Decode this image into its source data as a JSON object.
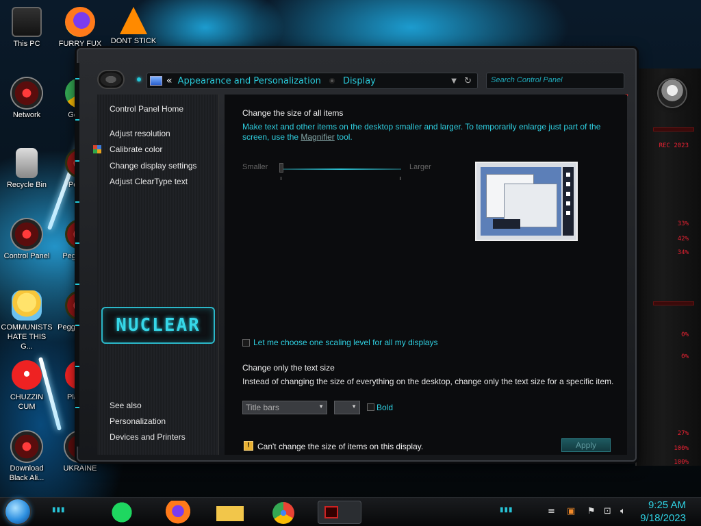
{
  "desktop": {
    "icons_col1": [
      {
        "label": "This PC",
        "icon": "computer-icon"
      },
      {
        "label": "Network",
        "icon": "network-icon"
      },
      {
        "label": "Recycle Bin",
        "icon": "recycle-bin-icon"
      },
      {
        "label": "Control Panel",
        "icon": "control-panel-icon"
      },
      {
        "label": "COMMUNISTS HATE THIS G...",
        "icon": "star-butterfly-icon"
      },
      {
        "label": "CHUZZIN CUM",
        "icon": "chuzzle-icon"
      },
      {
        "label": "Download Black Ali...",
        "icon": "alienware-icon"
      }
    ],
    "icons_col2": [
      {
        "label": "FURRY FUX",
        "icon": "firefox-icon"
      },
      {
        "label": "Go Chr",
        "icon": "chrome-icon"
      },
      {
        "label": "Peggle",
        "icon": "peggle-icon"
      },
      {
        "label": "Peggle De",
        "icon": "peggle-icon"
      },
      {
        "label": "Peggle of Wa",
        "icon": "peggle-icon"
      },
      {
        "label": "Plan Zo",
        "icon": "pvz-icon"
      },
      {
        "label": "UKRAINE",
        "icon": "ukraine-icon"
      }
    ],
    "icons_col3": [
      {
        "label": "DONT STICK",
        "icon": "vlc-icon"
      }
    ]
  },
  "gadgets": {
    "readouts": [
      "33%",
      "42%",
      "34%",
      "0%",
      "0%",
      "27%",
      "100%",
      "100%"
    ],
    "header": "REC 2023"
  },
  "window": {
    "breadcrumb": {
      "chevron": "«",
      "parent": "Appearance and Personalization",
      "current": "Display"
    },
    "search": {
      "placeholder": "Search Control Panel"
    },
    "help": "?"
  },
  "left_pane": {
    "home": "Control Panel Home",
    "links": [
      "Adjust resolution",
      "Calibrate color",
      "Change display settings",
      "Adjust ClearType text"
    ],
    "logo": "NUCLEAR",
    "see_also": "See also",
    "see_also_links": [
      "Personalization",
      "Devices and Printers"
    ]
  },
  "content": {
    "heading1": "Change the size of all items",
    "desc1_a": "Make text and other items on the desktop smaller and larger. To temporarily enlarge just part of the screen, use the ",
    "desc1_link": "Magnifier",
    "desc1_b": " tool.",
    "slider": {
      "min_label": "Smaller",
      "max_label": "Larger",
      "value": 0
    },
    "checkbox_label": "Let me choose one scaling level for all my displays",
    "checkbox_checked": false,
    "heading2": "Change only the text size",
    "desc2": "Instead of changing the size of everything on the desktop, change only the text size for a specific item.",
    "item_select": "Title bars",
    "size_select": "",
    "bold_label": "Bold",
    "bold_checked": false,
    "warning": "Can't change the size of items on this display.",
    "apply_label": "Apply"
  },
  "taskbar": {
    "apps": [
      "spotify-icon",
      "firefox-icon",
      "file-explorer-icon",
      "chrome-icon",
      "control-panel-icon"
    ],
    "time": "9:25 AM",
    "date": "9/18/2023"
  },
  "colors": {
    "accent": "#2fcfe0",
    "alert": "#e22b33"
  }
}
